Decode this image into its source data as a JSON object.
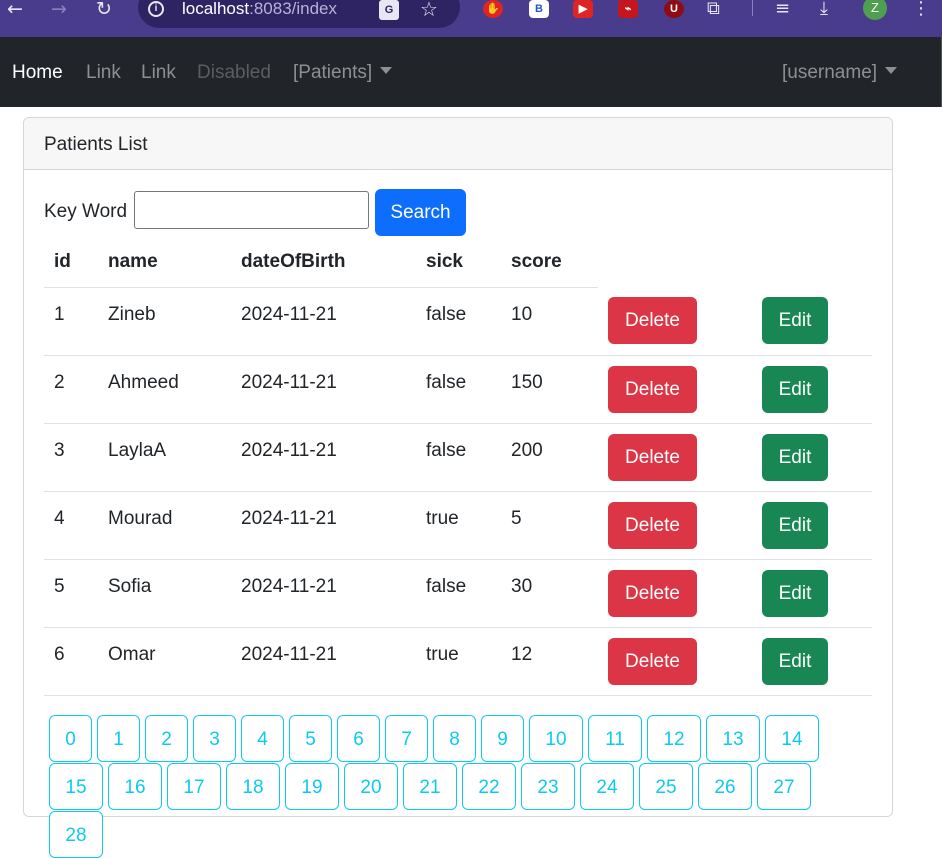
{
  "browser": {
    "url_host": "localhost",
    "url_rest": ":8083/index",
    "avatar_letter": "Z"
  },
  "navbar": {
    "links": [
      {
        "label": "Home",
        "state": "active"
      },
      {
        "label": "Link",
        "state": "normal"
      },
      {
        "label": "Link",
        "state": "normal"
      },
      {
        "label": "Disabled",
        "state": "disabled"
      }
    ],
    "patients_dropdown": "[Patients]",
    "user_dropdown": "[username]"
  },
  "card": {
    "title": "Patients List",
    "search_label": "Key Word",
    "search_value": "",
    "search_button": "Search"
  },
  "table": {
    "columns": [
      "id",
      "name",
      "dateOfBirth",
      "sick",
      "score"
    ],
    "delete_label": "Delete",
    "edit_label": "Edit",
    "rows": [
      {
        "id": "1",
        "name": "Zineb",
        "dateOfBirth": "2024-11-21",
        "sick": "false",
        "score": "10"
      },
      {
        "id": "2",
        "name": "Ahmeed",
        "dateOfBirth": "2024-11-21",
        "sick": "false",
        "score": "150"
      },
      {
        "id": "3",
        "name": "LaylaA",
        "dateOfBirth": "2024-11-21",
        "sick": "false",
        "score": "200"
      },
      {
        "id": "4",
        "name": "Mourad",
        "dateOfBirth": "2024-11-21",
        "sick": "true",
        "score": "5"
      },
      {
        "id": "5",
        "name": "Sofia",
        "dateOfBirth": "2024-11-21",
        "sick": "false",
        "score": "30"
      },
      {
        "id": "6",
        "name": "Omar",
        "dateOfBirth": "2024-11-21",
        "sick": "true",
        "score": "12"
      }
    ]
  },
  "pagination": {
    "pages": [
      "0",
      "1",
      "2",
      "3",
      "4",
      "5",
      "6",
      "7",
      "8",
      "9",
      "10",
      "11",
      "12",
      "13",
      "14",
      "15",
      "16",
      "17",
      "18",
      "19",
      "20",
      "21",
      "22",
      "23",
      "24",
      "25",
      "26",
      "27",
      "28"
    ]
  },
  "colors": {
    "navbar": "#212529",
    "delete": "#dc3545",
    "edit": "#198754",
    "search": "#0d6efd",
    "pager": "#0dcaf0"
  }
}
